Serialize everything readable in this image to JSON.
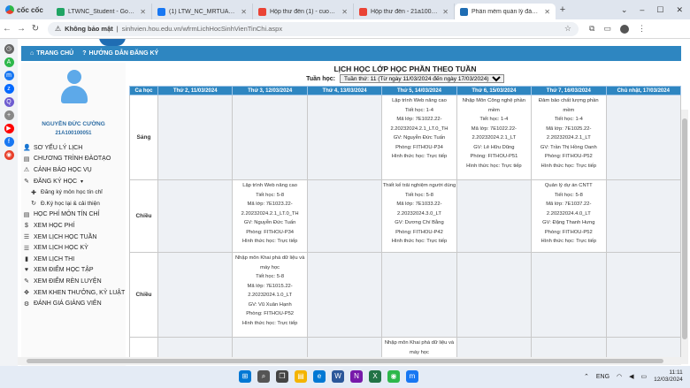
{
  "browser": {
    "brand": "cốc cốc",
    "tabs": [
      {
        "label": "LTWNC_Student - Google Drive",
        "icon": "google-drive-icon",
        "color": "#1fa463"
      },
      {
        "label": "(1) LTW_NC_MRTUAN_HKII_23...",
        "icon": "facebook-icon",
        "color": "#1877f2"
      },
      {
        "label": "Hộp thư đến (1) - cuong2k3api...",
        "icon": "gmail-icon",
        "color": "#ea4335"
      },
      {
        "label": "Hộp thư đến - 21a100100051...",
        "icon": "gmail-icon",
        "color": "#ea4335"
      },
      {
        "label": "Phần mềm quản lý đào tạo",
        "icon": "hou-icon",
        "color": "#1f6db3",
        "active": true
      }
    ],
    "insecure_label": "Không bảo mật",
    "url": "sinhvien.hou.edu.vn/wfrmLichHocSinhVienTinChi.aspx"
  },
  "navbar": {
    "home": "TRANG CHỦ",
    "guide": "HƯỚNG DẪN ĐĂNG KÝ"
  },
  "student": {
    "name": "NGUYỄN ĐỨC CƯỜNG",
    "id": "21A100100051"
  },
  "menu": [
    {
      "label": "SƠ YẾU LÝ LỊCH",
      "icon": "user-icon"
    },
    {
      "label": "CHƯƠNG TRÌNH ĐÀOTẠO",
      "icon": "document-icon"
    },
    {
      "label": "CẢNH BÁO HỌC VỤ",
      "icon": "warning-icon"
    },
    {
      "label": "ĐĂNG KÝ HỌC",
      "icon": "edit-icon",
      "dropdown": true
    },
    {
      "label": "Đăng ký môn học tín chỉ",
      "icon": "plus-icon",
      "sub": true
    },
    {
      "label": "Đ.Ký học lại & cải thiện",
      "icon": "refresh-icon",
      "sub": true
    },
    {
      "label": "HỌC PHÍ MÔN TÍN CHỈ",
      "icon": "document-icon"
    },
    {
      "label": "XEM HỌC PHÍ",
      "icon": "dollar-icon"
    },
    {
      "label": "XEM LỊCH HỌC TUẦN",
      "icon": "list-icon"
    },
    {
      "label": "XEM LỊCH HỌC KỲ",
      "icon": "list-icon"
    },
    {
      "label": "XEM LỊCH THI",
      "icon": "book-icon"
    },
    {
      "label": "XEM ĐIỂM HỌC TẬP",
      "icon": "heart-icon"
    },
    {
      "label": "XEM ĐIỂM RÈN LUYỆN",
      "icon": "pencil-icon"
    },
    {
      "label": "XEM KHEN THƯỞNG, KỶ LUẬT",
      "icon": "arrows-icon"
    },
    {
      "label": "ĐÁNH GIÁ GIẢNG VIÊN",
      "icon": "gear-icon"
    }
  ],
  "schedule": {
    "title": "LỊCH HỌC LỚP HỌC PHẦN THEO TUẦN",
    "week_label": "Tuần học:",
    "week_value": "Tuần thứ: 11 (Từ ngày 11/03/2024 đến ngày 17/03/2024)",
    "headers": [
      "Ca học",
      "Thứ 2, 11/03/2024",
      "Thứ 3, 12/03/2024",
      "Thứ 4, 13/03/2024",
      "Thứ 5, 14/03/2024",
      "Thứ 6, 15/03/2024",
      "Thứ 7, 16/03/2024",
      "Chủ nhật, 17/03/2024"
    ],
    "rows": [
      {
        "session": "Sáng",
        "cells": [
          [],
          [],
          [],
          [
            "Lập trình Web nâng cao",
            "Tiết học: 1-4",
            "Mã lớp: 7E1022.22-",
            "2.20232024.2.1_LT.0_TH",
            "GV: Nguyễn Đức Tuấn",
            "Phòng: FITHOU-P34",
            "Hình thức học: Trực tiếp"
          ],
          [
            "Nhập Môn Công nghệ phần",
            "mềm",
            "Tiết học: 1-4",
            "Mã lớp: 7E1022.22-",
            "2.20232024.2.1_LT",
            "GV: Lê Hữu Dũng",
            "Phòng: FITHOU-P51",
            "Hình thức học: Trực tiếp"
          ],
          [
            "Đảm bảo chất lượng phần",
            "mềm",
            "Tiết học: 1-4",
            "Mã lớp: 7E1025.22-",
            "2.20232024.2.1_LT",
            "GV: Trần Thị Hồng Oanh",
            "Phòng: FITHOU-P52",
            "Hình thức học: Trực tiếp"
          ],
          []
        ]
      },
      {
        "session": "Chiều",
        "cells": [
          [],
          [
            "Lập trình Web nâng cao",
            "Tiết học: 5-8",
            "Mã lớp: 7E1023.22-",
            "2.20232024.2.1_LT.0_TH",
            "GV: Nguyễn Đức Tuấn",
            "Phòng: FITHOU-P34",
            "Hình thức học: Trực tiếp"
          ],
          [],
          [
            "Thiết kế trải nghiệm người dùng",
            "Tiết học: 5-8",
            "Mã lớp: 7E1033.22-",
            "2.20232024.3.0_LT",
            "GV: Dương Chí Bằng",
            "Phòng: FITHOU-P42",
            "Hình thức học: Trực tiếp"
          ],
          [],
          [
            "Quản lý dự án CNTT",
            "Tiết học: 5-8",
            "Mã lớp: 7E1037.22-",
            "2.20232024.4.0_LT",
            "GV: Đặng Thanh Hưng",
            "Phòng: FITHOU-P52",
            "Hình thức học: Trực tiếp"
          ],
          []
        ]
      },
      {
        "session": "Chiều",
        "cells": [
          [],
          [
            "Nhập môn Khai phá dữ liệu và",
            "máy học",
            "Tiết học: 5-8",
            "Mã lớp: 7E1015.22-",
            "2.20232024.1.0_LT",
            "GV: Vũ Xuân Hạnh",
            "Phòng: FITHOU-P52",
            "Hình thức học: Trực tiếp"
          ],
          [],
          [],
          [],
          [],
          []
        ]
      },
      {
        "session": "",
        "cells": [
          [],
          [],
          [],
          [
            "Nhập môn Khai phá dữ liệu và",
            "máy học"
          ],
          [],
          [],
          []
        ]
      }
    ]
  },
  "taskbar": {
    "lang": "ENG",
    "time": "11:11",
    "date": "12/03/2024"
  }
}
